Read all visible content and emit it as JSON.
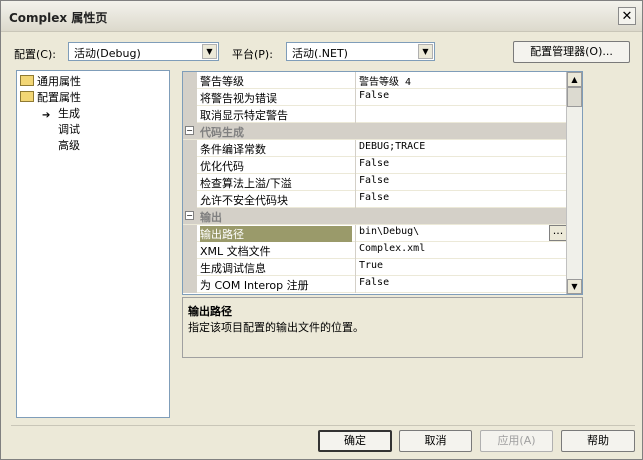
{
  "window": {
    "title": "Complex 属性页"
  },
  "toolbar": {
    "config_label": "配置(C):",
    "config_value": "活动(Debug)",
    "platform_label": "平台(P):",
    "platform_value": "活动(.NET)",
    "manager_label": "配置管理器(O)..."
  },
  "tree": {
    "items": [
      {
        "label": "通用属性"
      },
      {
        "label": "配置属性"
      },
      {
        "label": "生成"
      },
      {
        "label": "调试"
      },
      {
        "label": "高级"
      }
    ]
  },
  "grid": {
    "rows": [
      {
        "name": "警告等级",
        "value": "警告等级 4"
      },
      {
        "name": "将警告视为错误",
        "value": "False"
      },
      {
        "name": "取消显示特定警告",
        "value": ""
      },
      {
        "name": "代码生成",
        "value": ""
      },
      {
        "name": "条件编译常数",
        "value": "DEBUG;TRACE"
      },
      {
        "name": "优化代码",
        "value": "False"
      },
      {
        "name": "检查算法上溢/下溢",
        "value": "False"
      },
      {
        "name": "允许不安全代码块",
        "value": "False"
      },
      {
        "name": "输出",
        "value": ""
      },
      {
        "name": "输出路径",
        "value": "bin\\Debug\\"
      },
      {
        "name": "XML 文档文件",
        "value": "Complex.xml"
      },
      {
        "name": "生成调试信息",
        "value": "True"
      },
      {
        "name": "为 COM Interop 注册",
        "value": "False"
      }
    ]
  },
  "description": {
    "title": "输出路径",
    "text": "指定该项目配置的输出文件的位置。"
  },
  "buttons": {
    "ok": "确定",
    "cancel": "取消",
    "apply": "应用(A)",
    "help": "帮助"
  }
}
